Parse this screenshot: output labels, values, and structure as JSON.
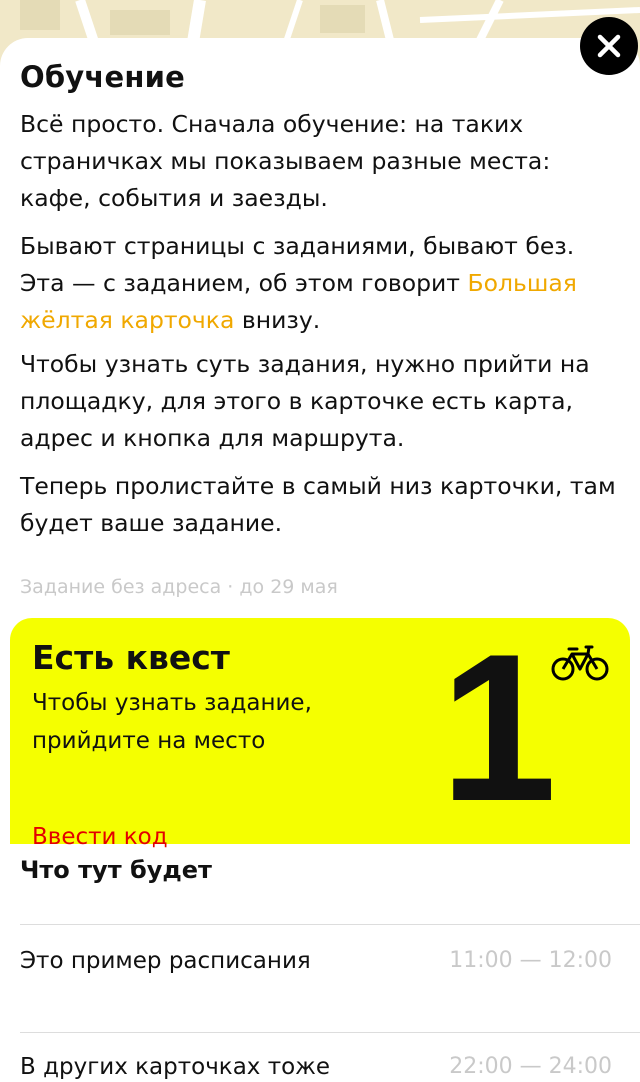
{
  "modal": {
    "title": "Обучение",
    "paragraphs": {
      "p1": "Всё просто. Сначала обучение: на таких страничках мы показываем разные места: кафе, события и заезды.",
      "p2_before": "Бывают страницы с заданиями, бывают без. Эта — с заданием, об этом говорит ",
      "p2_highlight": "Большая жёлтая карточка",
      "p2_after": " внизу.",
      "p3": "Чтобы узнать суть задания, нужно прийти на площадку, для этого в карточке есть карта, адрес и кнопка для маршрута.",
      "p4": "Теперь пролистайте в самый низ карточки, там будет ваше задание."
    },
    "meta": "Задание без адреса · до 29 мая"
  },
  "quest_card": {
    "title": "Есть квест",
    "description": "Чтобы узнать задание, прийдите на место",
    "enter_code": "Ввести код",
    "number": "1",
    "icon": "bicycle-icon"
  },
  "schedule": {
    "title": "Что тут будет",
    "items": [
      {
        "label": "Это пример расписания",
        "time": "11:00 — 12:00"
      },
      {
        "label": "В других карточках тоже",
        "time": "22:00 — 24:00"
      }
    ]
  },
  "colors": {
    "accent_yellow": "#f5ff00",
    "highlight_orange": "#f0a800",
    "code_red": "#e30000",
    "muted": "#c9c9c9"
  }
}
